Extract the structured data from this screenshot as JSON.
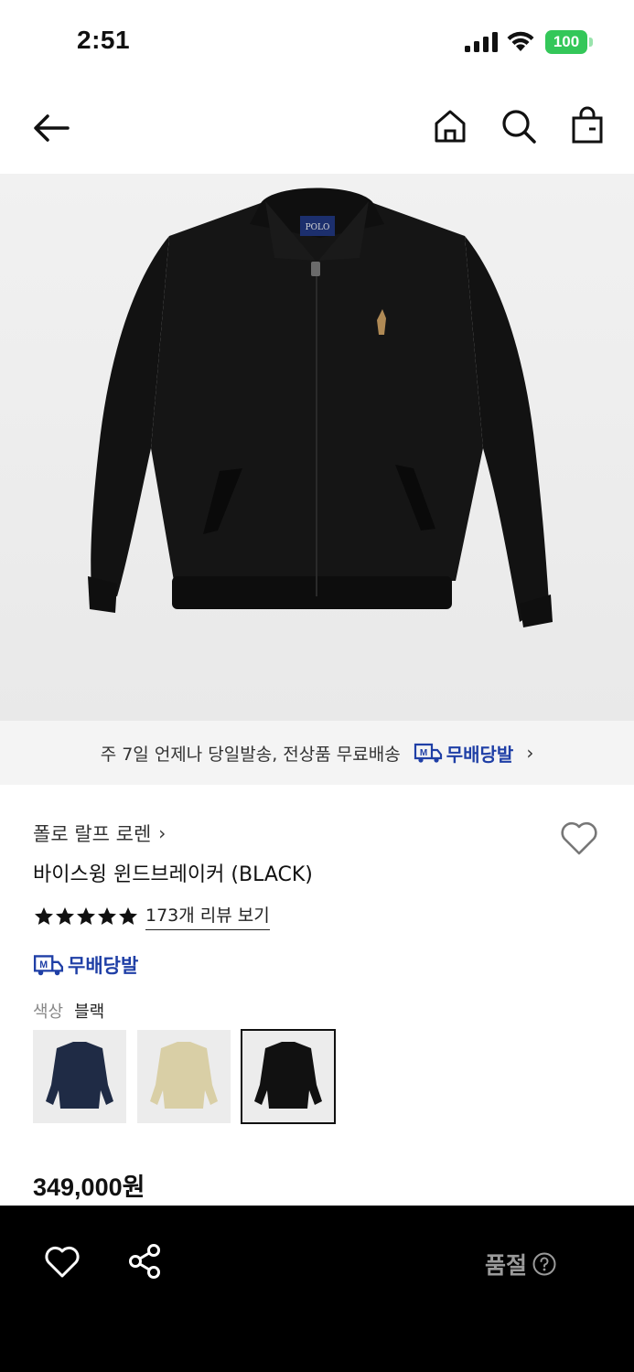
{
  "status_bar": {
    "time": "2:51",
    "battery": "100"
  },
  "nav": {
    "icons": [
      "back-arrow-icon",
      "home-icon",
      "search-icon",
      "shopping-bag-icon"
    ]
  },
  "hero": {
    "label": "POLO"
  },
  "shipping_banner": {
    "text": "주 7일 언제나 당일발송, 전상품 무료배송",
    "badge_logo": "M",
    "badge_text": "무배당발",
    "chevron": "›"
  },
  "product": {
    "brand": "폴로 랄프 로렌",
    "brand_chevron": "›",
    "name": "바이스윙 윈드브레이커 (BLACK)",
    "rating_stars": 5,
    "review_link": "173개 리뷰 보기",
    "badge_text": "무배당발",
    "color_label": "색상",
    "color_value": "블랙",
    "swatches": [
      {
        "color": "navy",
        "hex": "#1f2b45",
        "selected": false
      },
      {
        "color": "khaki",
        "hex": "#d9cfa6",
        "selected": false
      },
      {
        "color": "black",
        "hex": "#111111",
        "selected": true
      }
    ],
    "price": "349,000원"
  },
  "bottom_bar": {
    "status": "품절"
  },
  "colors": {
    "accent_blue": "#1f3fa6",
    "banner_bg": "#f4f4f4",
    "bottom_bg": "#000000",
    "sold_out_gray": "#9a9a9a",
    "battery_green": "#34c759"
  }
}
